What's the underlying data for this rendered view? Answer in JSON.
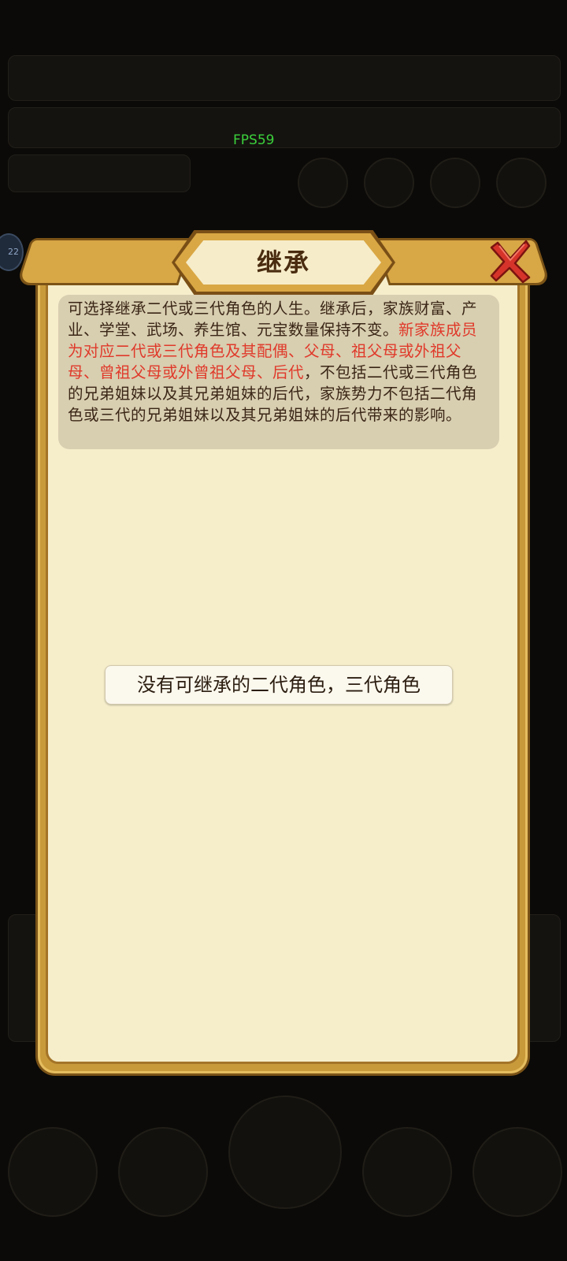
{
  "overlay": {
    "fps": "FPS59"
  },
  "dialog": {
    "title": "继承",
    "description_part1": "可选择继承二代或三代角色的人生。继承后，家族财富、产业、学堂、武场、养生馆、元宝数量保持不变。",
    "description_highlight": "新家族成员为对应二代或三代角色及其配偶、父母、祖父母或外祖父母、曾祖父母或外曾祖父母、后代",
    "description_part2": "，不包括二代或三代角色的兄弟姐妹以及其兄弟姐妹的后代，家族势力不包括二代角色或三代的兄弟姐妹以及其兄弟姐妹的后代带来的影响。",
    "empty_message": "没有可继承的二代角色，三代角色",
    "close_icon": "close-x-icon"
  },
  "colors": {
    "highlight_red": "#e0392a",
    "panel_bg": "#f6eecb",
    "frame_gold": "#c99a3a",
    "fps_green": "#3bd13b"
  }
}
